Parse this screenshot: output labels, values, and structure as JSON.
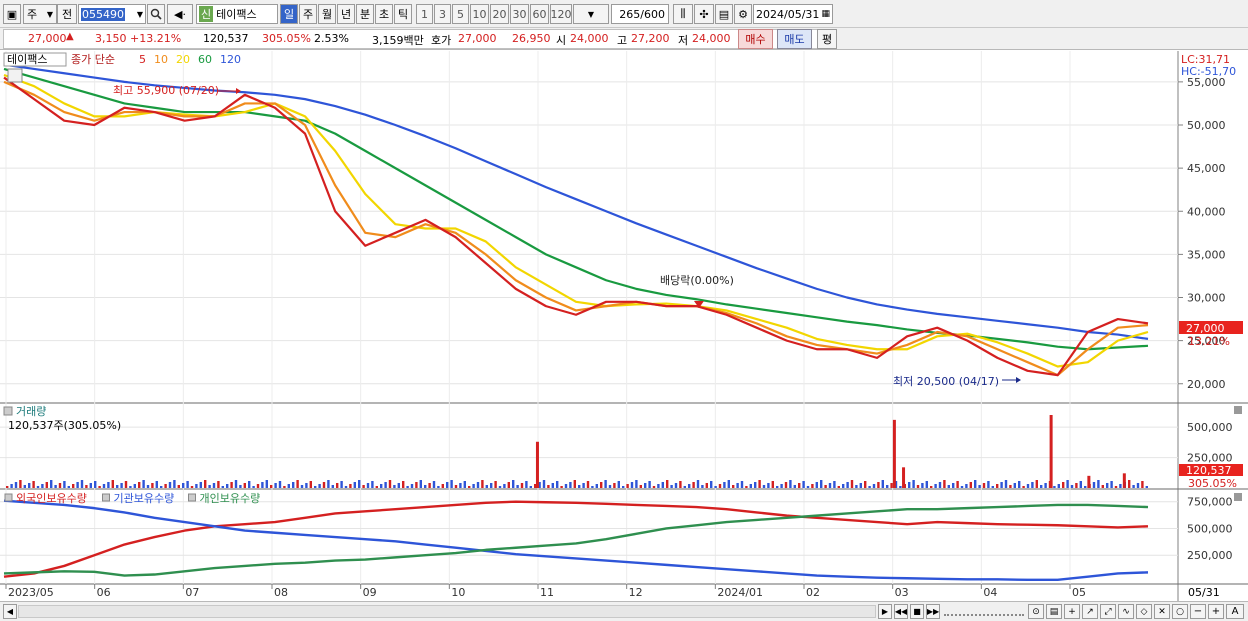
{
  "toolbar": {
    "mode_label": "주",
    "prev_label": "전",
    "code_value": "055490",
    "search_glyph": "Q",
    "new_badge": "신",
    "stock_name": "테이팩스",
    "period_tabs": [
      "일",
      "주",
      "월",
      "년",
      "분",
      "초",
      "틱"
    ],
    "minute_tabs": [
      "1",
      "3",
      "5",
      "10",
      "20",
      "30",
      "60",
      "120"
    ],
    "count_value": "265",
    "count_total": "/600",
    "date_value": "2024/05/31"
  },
  "quote": {
    "price": "27,000",
    "change": "3,150",
    "change_pct": "+13.21%",
    "volume": "120,537",
    "volume_ratio": "305.05%",
    "turnover": "2.53%",
    "amount": "3,159백만",
    "ask_label": "호가",
    "ask": "27,000",
    "bid": "26,950",
    "open_label": "시",
    "open": "24,000",
    "high_label": "고",
    "high": "27,200",
    "low_label": "저",
    "low": "24,000",
    "buy_label": "매수",
    "sell_label": "매도",
    "eval_label": "평"
  },
  "price_panel": {
    "stock_tag": "테이팩스",
    "legend_prefix": "종가 단순",
    "ma_labels": [
      "5",
      "10",
      "20",
      "60",
      "120"
    ],
    "ma_colors": [
      "#d42020",
      "#f08c1c",
      "#f2d600",
      "#199a40",
      "#2e55d8"
    ],
    "lc_label": "LC:31,71",
    "hc_label": "HC:-51,70",
    "high_annot": "최고 55,900 (07/20)",
    "low_annot": "최저 20,500 (04/17)",
    "dividend_annot": "배당락(0.00%)",
    "current_price_tag": "27,000",
    "current_pct_tag": "13.21%"
  },
  "volume_panel": {
    "title": "거래량",
    "current_value": "120,537주(305.05%)",
    "tag_value": "120,537",
    "tag_pct": "305.05%"
  },
  "holdings_panel": {
    "legend": [
      "외국인보유수량",
      "기관보유수량",
      "개인보유수량"
    ],
    "colors": [
      "#d42020",
      "#2e55d8",
      "#2f8f4f"
    ]
  },
  "x_axis": {
    "labels": [
      "2023/05",
      "06",
      "07",
      "08",
      "09",
      "10",
      "11",
      "12",
      "2024/01",
      "02",
      "03",
      "04",
      "05"
    ],
    "last_date": "05/31"
  },
  "chart_data": [
    {
      "type": "line",
      "panel": "price",
      "ylim": [
        18000,
        58000
      ],
      "y_ticks": [
        "55,000",
        "50,000",
        "45,000",
        "40,000",
        "35,000",
        "30,000",
        "25,000",
        "20,000"
      ],
      "y_tick_values": [
        55000,
        50000,
        45000,
        40000,
        35000,
        30000,
        25000,
        20000
      ],
      "series": [
        {
          "name": "5",
          "color": "#d42020",
          "values": [
            55500,
            53000,
            50500,
            50000,
            52000,
            51500,
            50500,
            51000,
            53500,
            52000,
            49000,
            40000,
            36000,
            37500,
            39000,
            37000,
            34000,
            31000,
            29000,
            28000,
            29500,
            29500,
            29000,
            29000,
            28000,
            26500,
            25000,
            24000,
            24000,
            23000,
            25500,
            26500,
            25000,
            23000,
            21500,
            21000,
            26000,
            27500,
            27000
          ]
        },
        {
          "name": "10",
          "color": "#f08c1c",
          "values": [
            55000,
            53500,
            51500,
            50500,
            51500,
            51500,
            51000,
            51000,
            52500,
            52500,
            50000,
            43000,
            37500,
            37000,
            38500,
            37500,
            35000,
            32000,
            30000,
            28500,
            29000,
            29500,
            29000,
            29000,
            28200,
            27000,
            25500,
            24500,
            24000,
            23500,
            24500,
            26000,
            25500,
            24000,
            22500,
            21000,
            24000,
            26500,
            26800
          ]
        },
        {
          "name": "20",
          "color": "#f2d600",
          "values": [
            55800,
            54500,
            52500,
            51000,
            51000,
            51500,
            51200,
            51000,
            51500,
            52500,
            51000,
            47000,
            42000,
            38500,
            38000,
            38000,
            36500,
            33500,
            31500,
            29500,
            29000,
            29200,
            29300,
            29000,
            28500,
            27500,
            26500,
            25200,
            24500,
            24000,
            24000,
            25500,
            25800,
            24800,
            23500,
            22000,
            22500,
            25000,
            26000
          ]
        },
        {
          "name": "60",
          "color": "#199a40",
          "values": [
            56500,
            55500,
            54500,
            53500,
            52500,
            52000,
            51500,
            51500,
            51500,
            51000,
            50500,
            49000,
            47000,
            45000,
            43000,
            41000,
            39000,
            37000,
            35000,
            33500,
            32000,
            31000,
            30300,
            29800,
            29200,
            28700,
            28200,
            27700,
            27200,
            26800,
            26300,
            25900,
            25600,
            25200,
            24800,
            24300,
            24000,
            24200,
            24400
          ]
        },
        {
          "name": "120",
          "color": "#2e55d8",
          "values": [
            57000,
            56500,
            56000,
            55500,
            55000,
            54600,
            54300,
            54000,
            53800,
            53500,
            53000,
            52200,
            51200,
            50000,
            48700,
            47300,
            45800,
            44300,
            42800,
            41400,
            40000,
            38600,
            37300,
            36000,
            34700,
            33400,
            32200,
            31000,
            30000,
            29200,
            28600,
            28100,
            27700,
            27300,
            26900,
            26500,
            26000,
            25700,
            25200
          ]
        }
      ]
    },
    {
      "type": "bar",
      "panel": "volume",
      "ylim": [
        0,
        600000
      ],
      "y_ticks": [
        "500,000",
        "250,000"
      ],
      "y_tick_values": [
        500000,
        250000
      ],
      "spikes": [
        {
          "x_frac": 0.465,
          "value": 380000
        },
        {
          "x_frac": 0.777,
          "value": 560000
        },
        {
          "x_frac": 0.785,
          "value": 170000
        },
        {
          "x_frac": 0.914,
          "value": 600000
        },
        {
          "x_frac": 0.947,
          "value": 100000
        },
        {
          "x_frac": 0.978,
          "value": 120537
        }
      ]
    },
    {
      "type": "line",
      "panel": "holdings",
      "ylim": [
        0,
        850000
      ],
      "y_ticks": [
        "750,000",
        "500,000",
        "250,000"
      ],
      "y_tick_values": [
        750000,
        500000,
        250000
      ],
      "series": [
        {
          "name": "외국인보유수량",
          "color": "#d42020",
          "values": [
            50000,
            80000,
            150000,
            250000,
            350000,
            420000,
            480000,
            520000,
            540000,
            560000,
            600000,
            640000,
            660000,
            680000,
            700000,
            720000,
            740000,
            750000,
            745000,
            740000,
            730000,
            720000,
            710000,
            700000,
            680000,
            650000,
            620000,
            600000,
            580000,
            560000,
            540000,
            560000,
            550000,
            540000,
            535000,
            530000,
            520000,
            510000,
            520000
          ]
        },
        {
          "name": "기관보유수량",
          "color": "#2e55d8",
          "values": [
            760000,
            740000,
            720000,
            690000,
            650000,
            600000,
            560000,
            520000,
            480000,
            460000,
            440000,
            420000,
            400000,
            380000,
            350000,
            320000,
            290000,
            260000,
            240000,
            220000,
            200000,
            180000,
            160000,
            140000,
            120000,
            100000,
            80000,
            60000,
            50000,
            40000,
            35000,
            30000,
            25000,
            25000,
            20000,
            20000,
            50000,
            80000,
            90000
          ]
        },
        {
          "name": "개인보유수량",
          "color": "#2f8f4f",
          "values": [
            80000,
            90000,
            100000,
            95000,
            60000,
            70000,
            100000,
            130000,
            150000,
            170000,
            180000,
            200000,
            210000,
            230000,
            250000,
            270000,
            300000,
            320000,
            340000,
            360000,
            400000,
            450000,
            500000,
            530000,
            560000,
            580000,
            600000,
            620000,
            640000,
            660000,
            680000,
            680000,
            690000,
            700000,
            710000,
            720000,
            720000,
            710000,
            700000
          ]
        }
      ]
    }
  ]
}
